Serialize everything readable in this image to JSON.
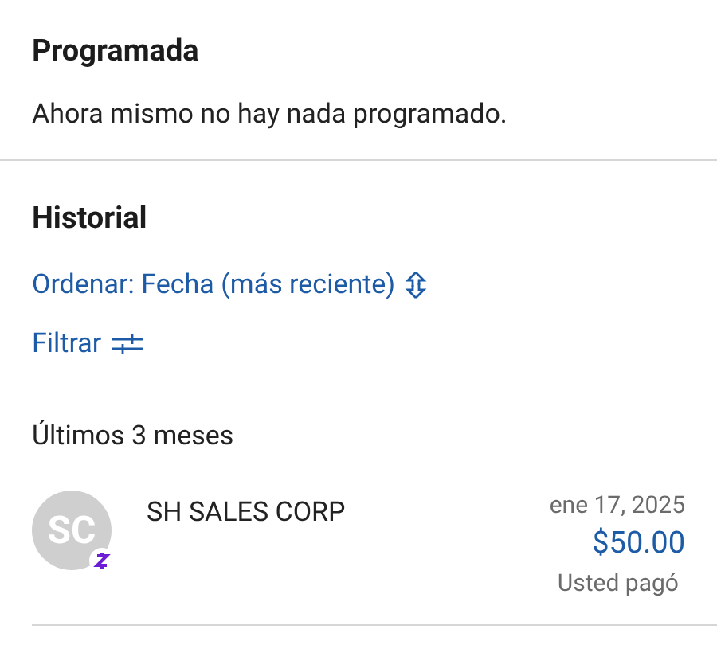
{
  "scheduled": {
    "title": "Programada",
    "message": "Ahora mismo no hay nada programado."
  },
  "history": {
    "title": "Historial",
    "sort_link": "Ordenar: Fecha (más reciente)",
    "filter_link": "Filtrar",
    "period": "Últimos 3 meses",
    "transactions": [
      {
        "initials": "SC",
        "name": "SH SALES CORP",
        "date": "ene 17, 2025",
        "amount": "$50.00",
        "status": "Usted pagó"
      }
    ]
  }
}
